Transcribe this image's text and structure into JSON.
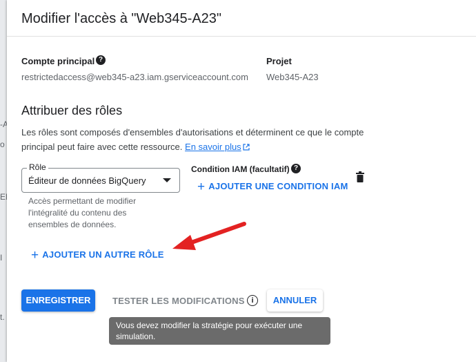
{
  "dialog": {
    "title": "Modifier l'accès à \"Web345-A23\""
  },
  "principal": {
    "label": "Compte principal",
    "value": "restrictedaccess@web345-a23.iam.gserviceaccount.com"
  },
  "project": {
    "label": "Projet",
    "value": "Web345-A23"
  },
  "roles_section": {
    "heading": "Attribuer des rôles",
    "description": "Les rôles sont composés d'ensembles d'autorisations et déterminent ce que le compte principal peut faire avec cette ressource.",
    "learn_more": "En savoir plus"
  },
  "role_select": {
    "label": "Rôle",
    "value": "Éditeur de données BigQuery",
    "hint": "Accès permettant de modifier l'intégralité du contenu des ensembles de données."
  },
  "condition": {
    "label": "Condition IAM (facultatif)",
    "add_label": "AJOUTER UNE CONDITION IAM"
  },
  "add_role": {
    "label": "AJOUTER UN AUTRE RÔLE"
  },
  "actions": {
    "save": "ENREGISTRER",
    "test": "TESTER LES MODIFICATIONS",
    "cancel": "ANNULER"
  },
  "tooltip": {
    "text": "Vous devez modifier la stratégie pour exécuter une simulation."
  },
  "background": {
    "fragments": [
      "-A",
      "o",
      "EI",
      "I",
      "t."
    ]
  },
  "colors": {
    "accent": "#1a73e8",
    "arrow": "#e32222",
    "tooltip_bg": "#6b6b6b"
  },
  "icons": {
    "help": "help-circle-icon",
    "external": "external-link-icon",
    "delete": "trash-icon",
    "info": "info-icon",
    "add": "plus-icon",
    "dropdown": "caret-down-icon"
  }
}
